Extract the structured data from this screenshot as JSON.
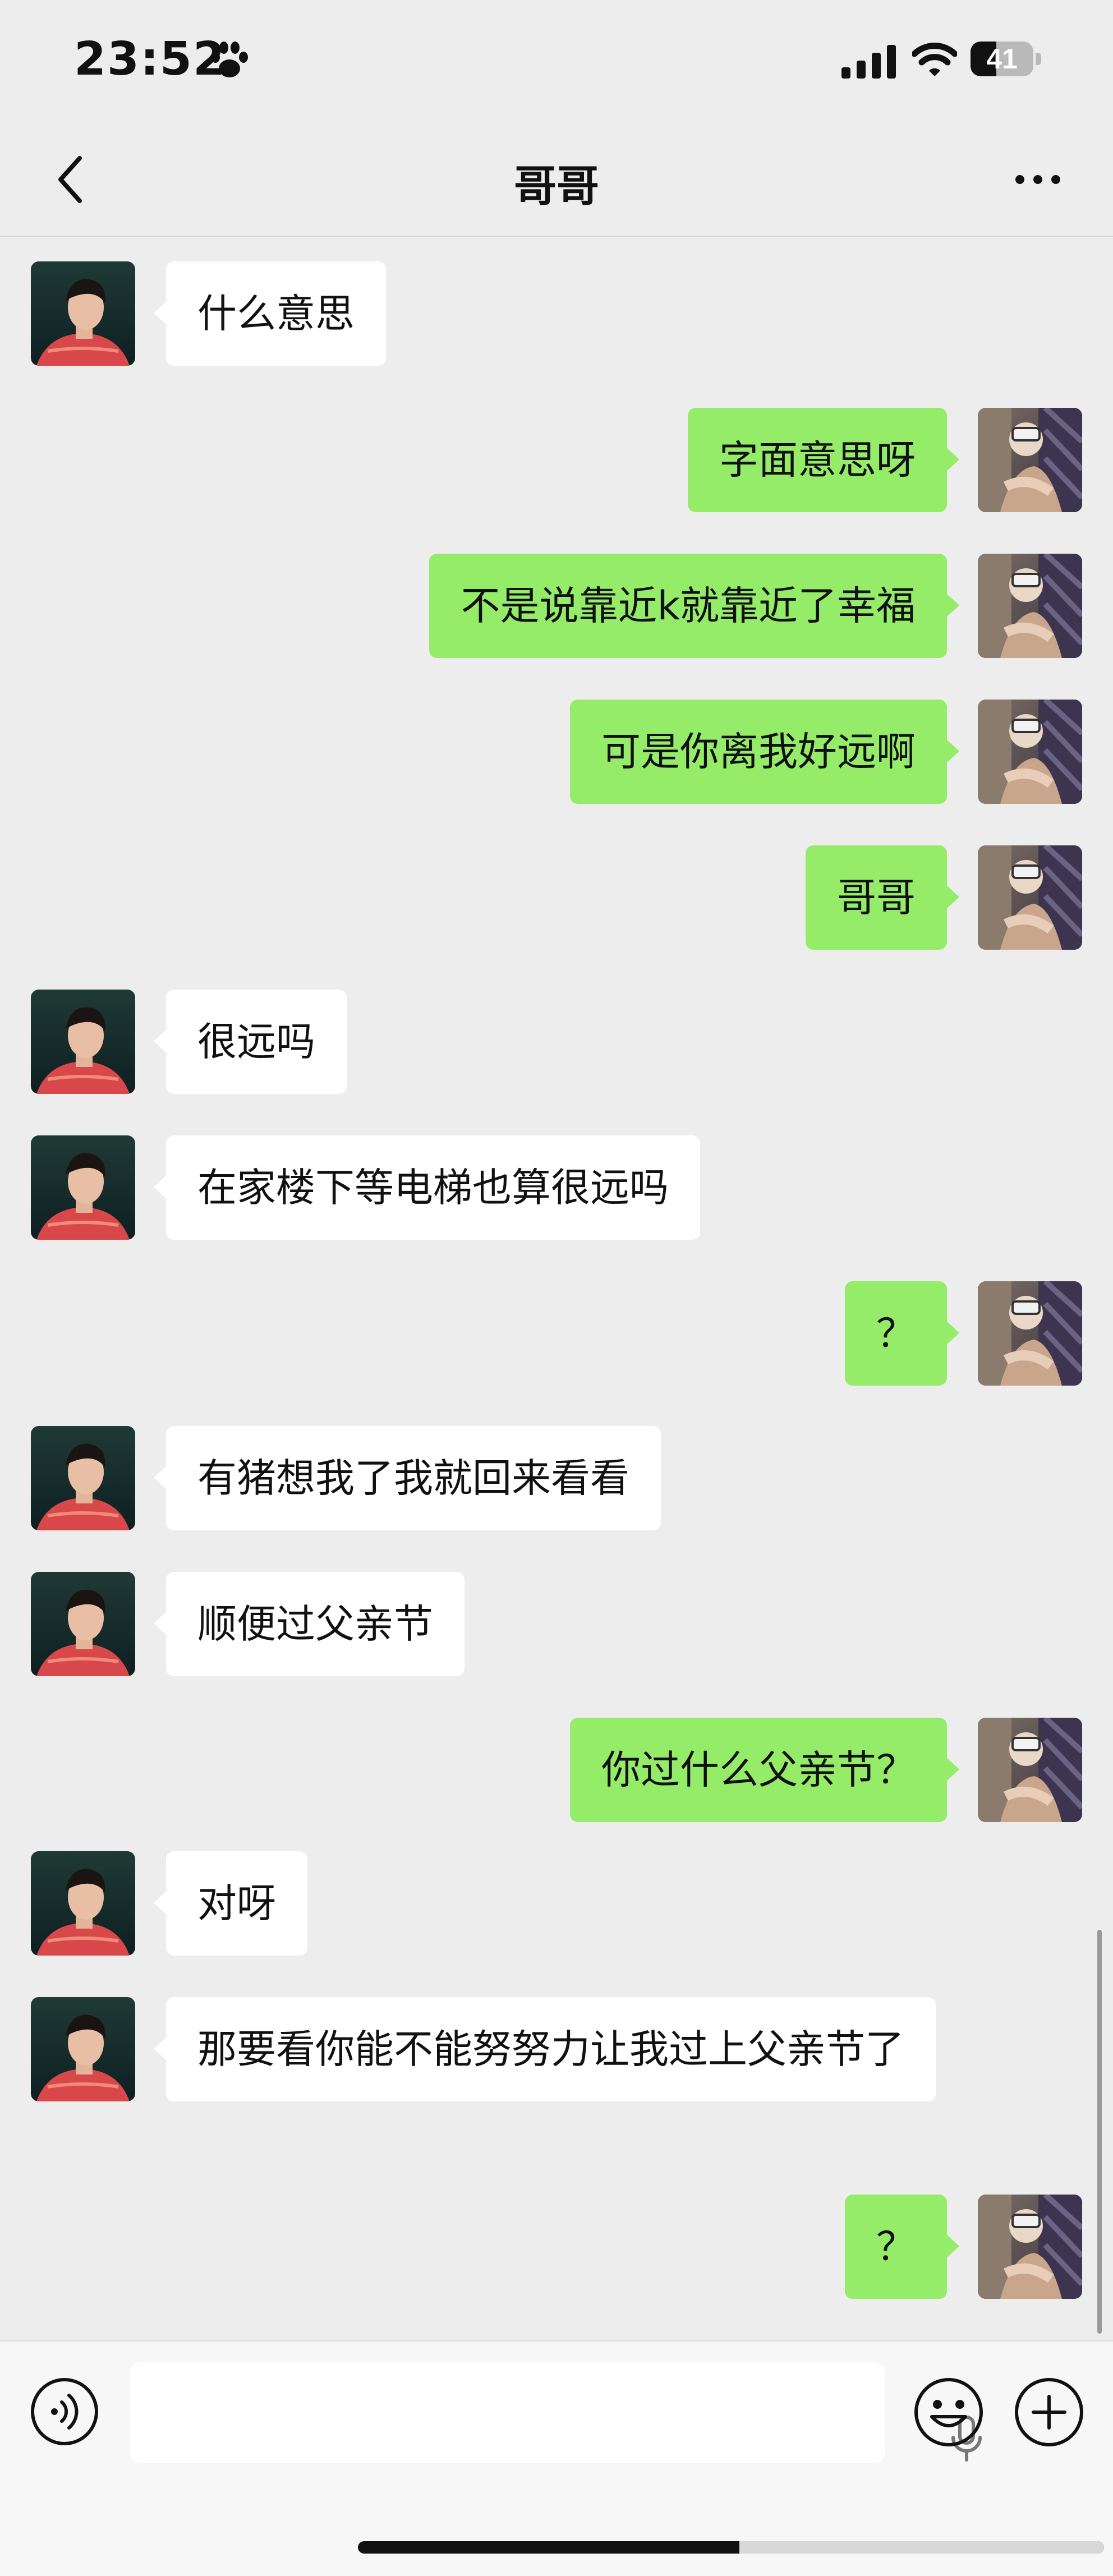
{
  "status_bar": {
    "time": "23:52",
    "battery": "41",
    "battery_level": 0.41,
    "icons": [
      "paw-icon",
      "signal-icon",
      "wifi-icon",
      "battery-icon"
    ]
  },
  "header": {
    "title": "哥哥",
    "back_icon": "chevron-left-icon",
    "more_icon": "more-horizontal-icon"
  },
  "messages": [
    {
      "side": "received",
      "text": "什么意思"
    },
    {
      "side": "sent",
      "text": "字面意思呀"
    },
    {
      "side": "sent",
      "text": "不是说靠近k就靠近了幸福"
    },
    {
      "side": "sent",
      "text": "可是你离我好远啊"
    },
    {
      "side": "sent",
      "text": "哥哥"
    },
    {
      "side": "received",
      "text": "很远吗"
    },
    {
      "side": "received",
      "text": "在家楼下等电梯也算很远吗"
    },
    {
      "side": "sent",
      "text": "？"
    },
    {
      "side": "received",
      "text": "有猪想我了我就回来看看"
    },
    {
      "side": "received",
      "text": "顺便过父亲节"
    },
    {
      "side": "sent",
      "text": "你过什么父亲节？"
    },
    {
      "side": "received",
      "text": "对呀"
    },
    {
      "side": "received",
      "text": "那要看你能不能努努力让我过上父亲节了"
    },
    {
      "side": "sent",
      "text": "？"
    }
  ],
  "input_bar": {
    "value": "",
    "icons": [
      "voice-icon",
      "microphone-icon",
      "emoji-icon",
      "plus-icon"
    ]
  },
  "colors": {
    "background": "#ededed",
    "sent_bubble": "#95ec69",
    "received_bubble": "#ffffff"
  }
}
